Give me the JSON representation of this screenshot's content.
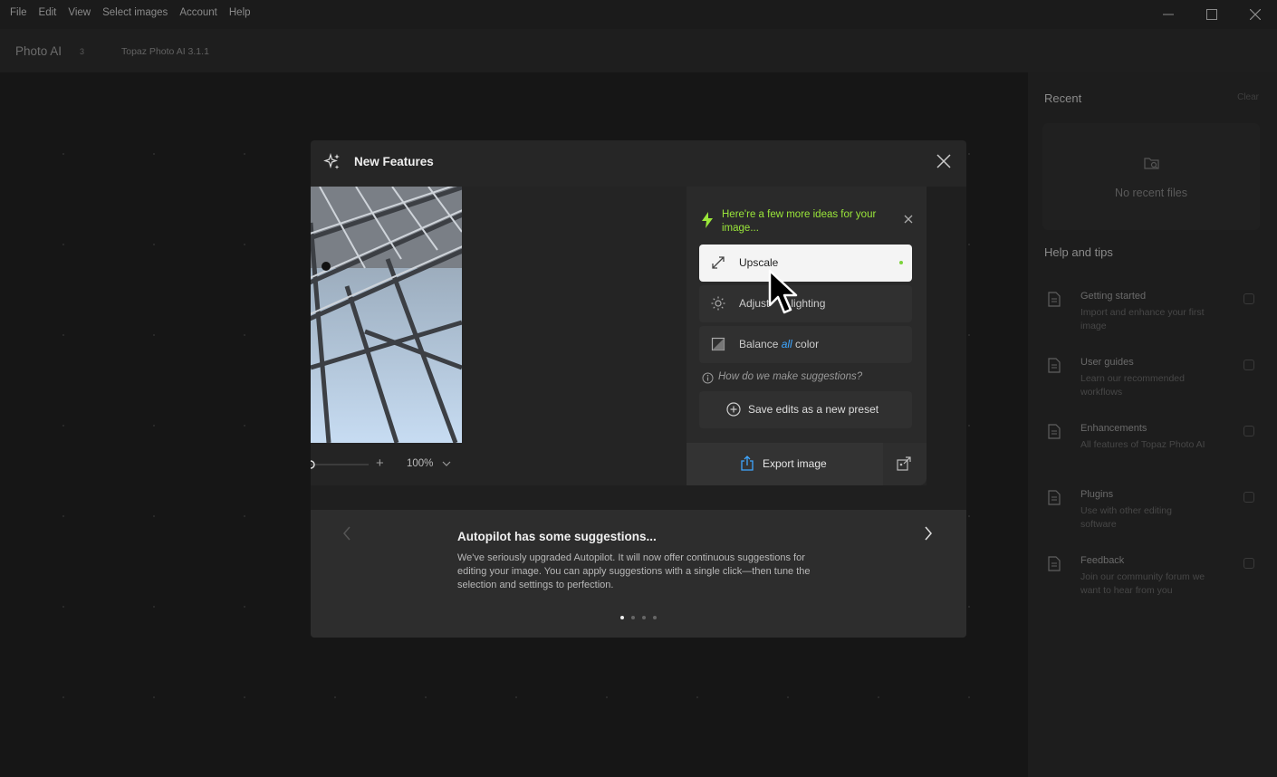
{
  "menu": [
    "File",
    "Edit",
    "View",
    "Select images",
    "Account",
    "Help"
  ],
  "app": {
    "name": "Photo AI",
    "badge": "3",
    "version": "Topaz Photo AI 3.1.1"
  },
  "recent": {
    "title": "Recent",
    "clear": "Clear",
    "empty": "No recent files"
  },
  "help": {
    "title": "Help and tips",
    "items": [
      {
        "name": "Getting started",
        "desc": "Import and enhance your first image"
      },
      {
        "name": "User guides",
        "desc": "Learn our recommended workflows"
      },
      {
        "name": "Enhancements",
        "desc": "All features of Topaz Photo AI"
      },
      {
        "name": "Plugins",
        "desc": "Use with other editing software"
      },
      {
        "name": "Feedback",
        "desc": "Join our community forum we want to hear from you"
      }
    ]
  },
  "modal": {
    "title": "New Features",
    "preview": {
      "zoom": "100%",
      "suggestions_header": "Here're a few more ideas for your image...",
      "buttons": [
        {
          "label": "Upscale"
        },
        {
          "label_pre": "Adjust",
          "label_post": "lighting"
        },
        {
          "label_pre": "Balance ",
          "label_em": "all",
          "label_post": " color"
        }
      ],
      "how": "How do we make suggestions?",
      "save_preset": "Save edits as a new preset",
      "export": "Export image"
    },
    "info": {
      "title": "Autopilot has some suggestions...",
      "body": "We've seriously upgraded Autopilot. It will now offer continuous suggestions for editing your image. You can apply suggestions with a single click—then tune the selection and settings to perfection.",
      "page_count": 4,
      "active_page": 1
    }
  },
  "colors": {
    "accent_green": "#9ae63a",
    "accent_blue": "#3ea6ff"
  },
  "icons": [
    "sparkles-icon",
    "close-icon",
    "lightning-icon",
    "expand-arrows-icon",
    "sun-icon",
    "color-balance-icon",
    "info-icon",
    "plus-circle-icon",
    "share-icon",
    "export-alt-icon",
    "chevron-left-icon",
    "chevron-right-icon",
    "document-icon",
    "folder-search-icon",
    "cursor-icon"
  ]
}
